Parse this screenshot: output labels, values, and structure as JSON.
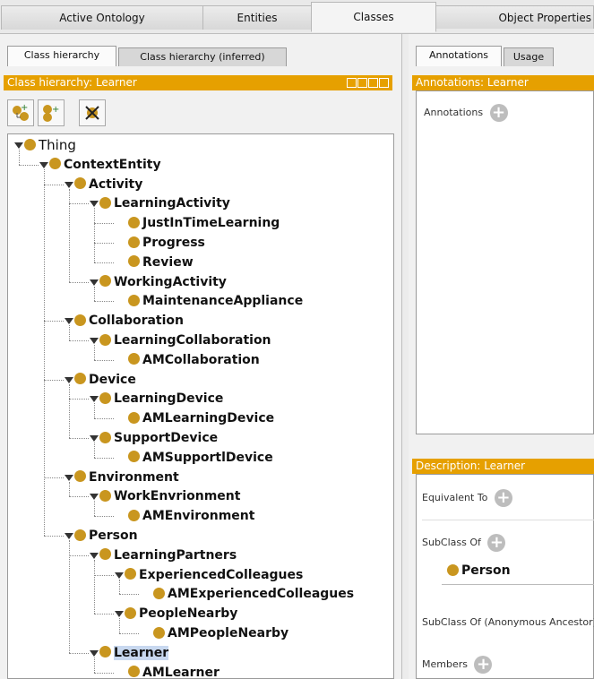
{
  "top_tabs": [
    "Active Ontology",
    "Entities",
    "Classes",
    "Object Properties"
  ],
  "left": {
    "sub_tabs": [
      "Class hierarchy",
      "Class hierarchy (inferred)"
    ],
    "header": "Class hierarchy: Learner",
    "toolbar": [
      "add-subclass-icon",
      "add-sibling-icon",
      "delete-class-icon"
    ],
    "tree": [
      "Thing",
      "ContextEntity",
      "Activity",
      "LearningActivity",
      "JustInTimeLearning",
      "Progress",
      "Review",
      "WorkingActivity",
      "MaintenanceAppliance",
      "Collaboration",
      "LearningCollaboration",
      "AMCollaboration",
      "Device",
      "LearningDevice",
      "AMLearningDevice",
      "SupportDevice",
      "AMSupportlDevice",
      "Environment",
      "WorkEnvrionment",
      "AMEnvironment",
      "Person",
      "LearningPartners",
      "ExperiencedColleagues",
      "AMExperiencedColleagues",
      "PeopleNearby",
      "AMPeopleNearby",
      "Learner",
      "AMLearner"
    ],
    "selected": "Learner"
  },
  "right": {
    "tabs": [
      "Annotations",
      "Usage"
    ],
    "annotations_header": "Annotations: Learner",
    "annotations_label": "Annotations",
    "description_header": "Description: Learner",
    "equivalent_label": "Equivalent To",
    "subclass_label": "SubClass Of",
    "subclass_value": "Person",
    "anon_label": "SubClass Of (Anonymous Ancestor)",
    "members_label": "Members"
  },
  "colors": {
    "header": "#e6a000",
    "class_dot": "#c9961f",
    "selection": "#c8d8ef"
  }
}
